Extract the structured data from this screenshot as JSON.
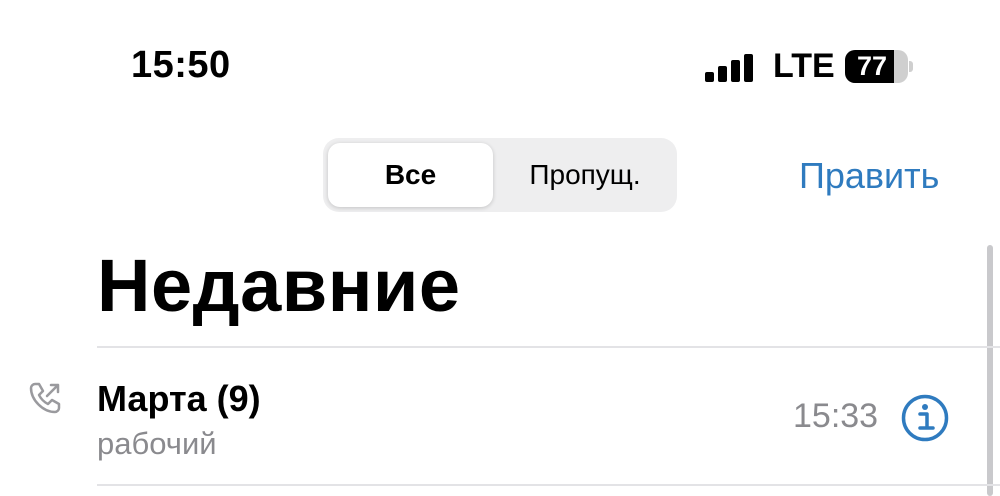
{
  "status_bar": {
    "time": "15:50",
    "network": "LTE",
    "battery_level": "77",
    "battery_fraction": 0.77,
    "signal_bars": 4
  },
  "segmented_control": {
    "all_label": "Все",
    "missed_label": "Пропущ.",
    "selected": "Все"
  },
  "nav": {
    "edit_label": "Править"
  },
  "page": {
    "title": "Недавние"
  },
  "calls": [
    {
      "name": "Марта (9)",
      "label": "рабочий",
      "time": "15:33",
      "direction_icon": "outgoing-call-icon"
    }
  ],
  "colors": {
    "accent": "#2f7bbf",
    "secondary_text": "#8a8a8e",
    "separator": "#e3e3e6"
  }
}
